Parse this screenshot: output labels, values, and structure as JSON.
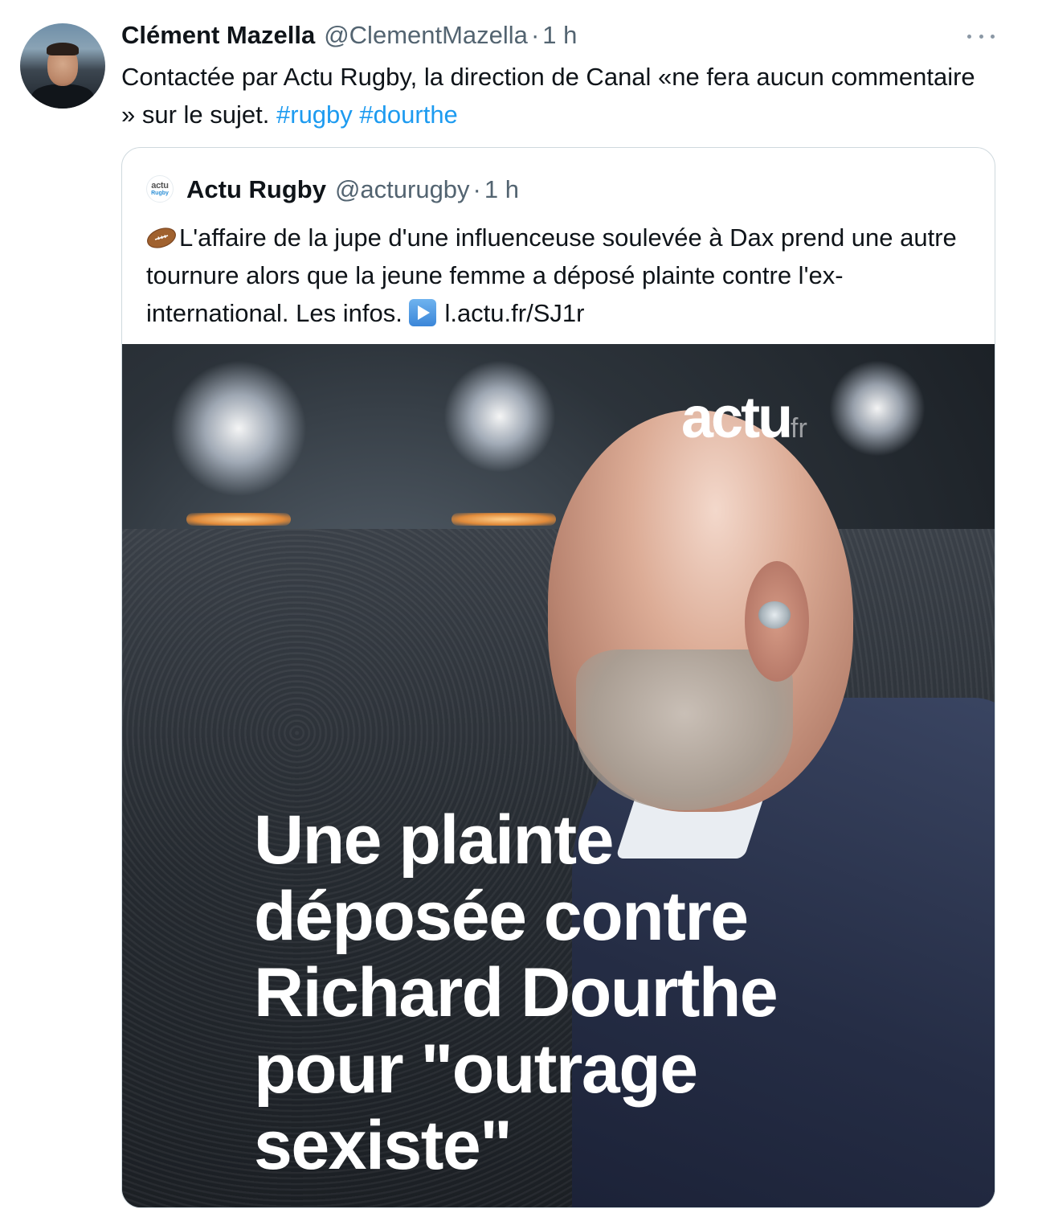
{
  "tweet": {
    "display_name": "Clément Mazella",
    "handle": "@ClementMazella",
    "separator": "·",
    "time": "1 h",
    "text": "Contactée par Actu Rugby, la direction de Canal «ne fera aucun commentaire » sur le sujet.",
    "hashtags": [
      "#rugby",
      "#dourthe"
    ],
    "more_icon": "more-horizontal-icon"
  },
  "quote": {
    "avatar_text_top": "actu",
    "avatar_text_bottom": "Rugby",
    "display_name": "Actu Rugby",
    "handle": "@acturugby",
    "separator": "·",
    "time": "1 h",
    "emoji_lead": "rugby-football-icon",
    "text": "L'affaire de la jupe d'une influenceuse soulevée à Dax prend une autre tournure alors que la jeune femme a déposé plainte contre l'ex-international. Les infos.",
    "emoji_link": "play-button-icon",
    "link": "l.actu.fr/SJ1r"
  },
  "media": {
    "logo": "actu",
    "logo_suffix": "fr",
    "headline_lines": [
      "Une plainte",
      "déposée contre",
      "Richard Dourthe",
      "pour \"outrage",
      "sexiste\""
    ]
  },
  "colors": {
    "link": "#1d9bf0",
    "secondary_text": "#536471",
    "border": "#cfd9de"
  }
}
